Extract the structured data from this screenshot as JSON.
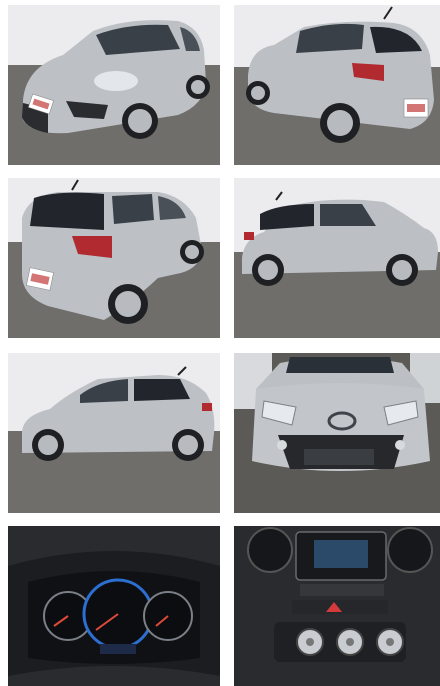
{
  "gallery": {
    "photos": [
      {
        "subject": "car-front-three-quarter",
        "plate_text": "",
        "badge_text": ""
      },
      {
        "subject": "car-rear-three-quarter-right",
        "plate_text": "",
        "badge_text": ""
      },
      {
        "subject": "car-rear-three-quarter-left",
        "plate_text": "",
        "badge_text": ""
      },
      {
        "subject": "car-side-right",
        "plate_text": "",
        "badge_text": ""
      },
      {
        "subject": "car-side-left",
        "plate_text": "",
        "badge_text": ""
      },
      {
        "subject": "car-front-close",
        "plate_text": "",
        "badge_text": ""
      },
      {
        "subject": "instrument-cluster",
        "plate_text": "",
        "badge_text": ""
      },
      {
        "subject": "center-console",
        "plate_text": "",
        "badge_text": ""
      }
    ]
  },
  "colors": {
    "car_silver": "#bcc0c5",
    "car_shadow": "#8e9399",
    "ground": "#6b6a66",
    "wall": "#e9eaec",
    "plate_red": "#c23b3b",
    "dash_black": "#1c1d20",
    "gauge_blue": "#2d6fd1"
  }
}
